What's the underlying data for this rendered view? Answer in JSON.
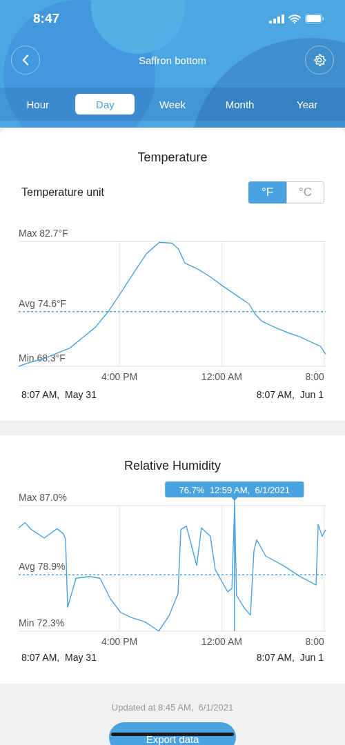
{
  "status_bar": {
    "time": "8:47"
  },
  "header": {
    "title": "Saffron bottom"
  },
  "tabs": [
    {
      "label": "Hour",
      "selected": false
    },
    {
      "label": "Day",
      "selected": true
    },
    {
      "label": "Week",
      "selected": false
    },
    {
      "label": "Month",
      "selected": false
    },
    {
      "label": "Year",
      "selected": false
    }
  ],
  "cards": [
    {
      "title": "Temperature",
      "unit_label": "Temperature unit",
      "units": [
        {
          "label": "°F",
          "selected": true
        },
        {
          "label": "°C",
          "selected": false
        }
      ],
      "chart": {
        "y_labels": [
          "Max 82.7°F",
          "Avg 74.6°F",
          "Min 68.3°F"
        ],
        "x_labels": [
          "4:00 PM",
          "12:00 AM",
          "8:00"
        ]
      },
      "start_label": "8:07 AM,  May 31",
      "end_label": "8:07 AM,  Jun 1"
    },
    {
      "title": "Relative Humidity",
      "chart": {
        "y_labels": [
          "Max 87.0%",
          "Avg 78.9%",
          "Min 72.3%"
        ],
        "x_labels": [
          "4:00 PM",
          "12:00 AM",
          "8:00"
        ],
        "tooltip": "76.7%  12:59 AM,  6/1/2021"
      },
      "start_label": "8:07 AM,  May 31",
      "end_label": "8:07 AM,  Jun 1"
    }
  ],
  "footer": {
    "updated": "Updated at 8:45 AM,  6/1/2021",
    "export_button": "Export data"
  }
}
